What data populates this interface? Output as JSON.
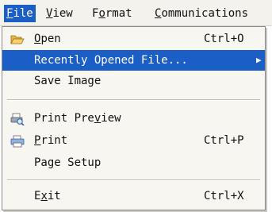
{
  "menubar": {
    "items": [
      {
        "mnemonic": "F",
        "rest": "ile"
      },
      {
        "mnemonic": "V",
        "rest": "iew"
      },
      {
        "pre": "F",
        "mnemonic": "o",
        "rest": "rmat"
      },
      {
        "mnemonic": "C",
        "rest": "ommunications"
      }
    ]
  },
  "file_menu": {
    "items": [
      {
        "label_mnemonic": "O",
        "label_rest": "pen",
        "shortcut": "Ctrl+O",
        "icon": "folder-open-icon"
      },
      {
        "label": "Recently Opened File...",
        "submenu": true,
        "arrow": "▶"
      },
      {
        "label": "Save Image"
      },
      {
        "label_pre": "Print Pre",
        "label_mnemonic": "v",
        "label_rest": "iew",
        "icon": "print-preview-icon"
      },
      {
        "label_mnemonic": "P",
        "label_rest": "rint",
        "shortcut": "Ctrl+P",
        "icon": "printer-icon"
      },
      {
        "label": "Page Setup"
      },
      {
        "label_pre": "E",
        "label_mnemonic": "x",
        "label_rest": "it",
        "shortcut": "Ctrl+X"
      }
    ]
  },
  "colors": {
    "highlight": "#1b5fc6",
    "menu_bg": "#f7f6f1",
    "bar_bg": "#f3f2ec"
  }
}
